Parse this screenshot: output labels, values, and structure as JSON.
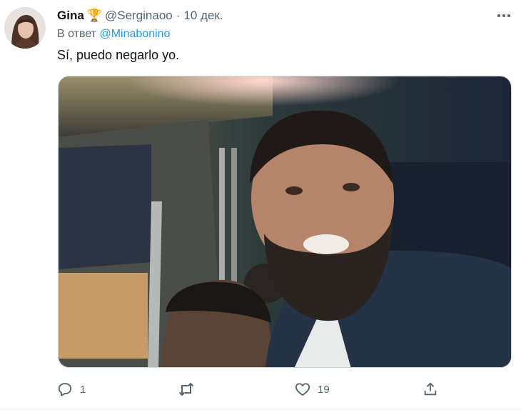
{
  "tweet": {
    "author_name": "Gina",
    "author_emoji": "🏆",
    "author_handle": "@Serginaoo",
    "separator": "·",
    "date": "10 дек.",
    "more_icon": "more-horizontal-icon",
    "reply_prefix": "В ответ",
    "reply_to": "@Minabonino",
    "text": "Sí, puedo negarlo yo.",
    "media_description_icon": "photo"
  },
  "actions": {
    "reply_count": "1",
    "retweet_count": "",
    "like_count": "19",
    "share_count": ""
  },
  "colors": {
    "text": "#0f1419",
    "muted": "#536471",
    "link": "#1d9bf0",
    "border": "#cfd9de"
  }
}
